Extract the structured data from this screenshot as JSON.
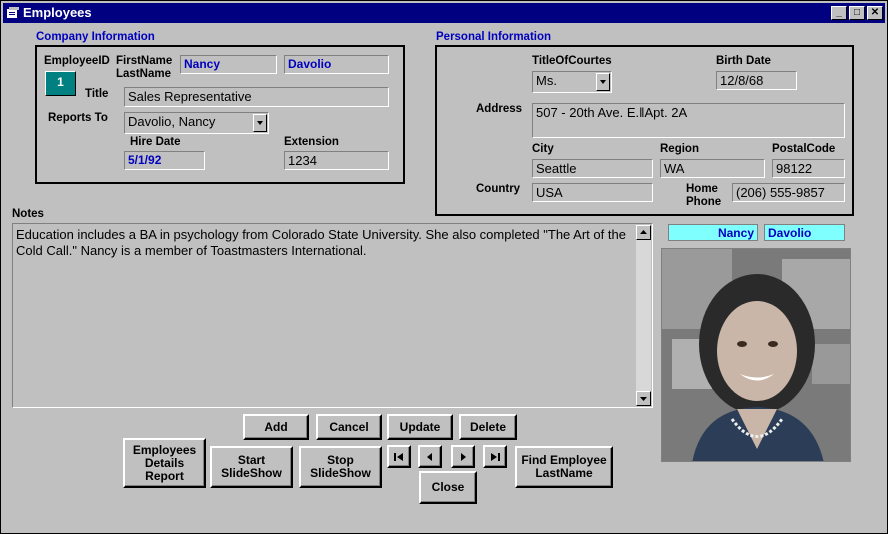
{
  "window": {
    "title": "Employees"
  },
  "company": {
    "heading": "Company Information",
    "employee_id_label": "EmployeeID",
    "employee_id": "1",
    "firstname_label": "FirstName",
    "lastname_label": "LastName",
    "first_name": "Nancy",
    "last_name": "Davolio",
    "title_label": "Title",
    "title": "Sales Representative",
    "reports_to_label": "Reports To",
    "reports_to": "Davolio, Nancy",
    "hire_date_label": "Hire Date",
    "hire_date": "5/1/92",
    "extension_label": "Extension",
    "extension": "1234"
  },
  "personal": {
    "heading": "Personal Information",
    "courtesy_label": "TitleOfCourtes",
    "courtesy": "Ms.",
    "birth_label": "Birth Date",
    "birth_date": "12/8/68",
    "address_label": "Address",
    "address": "507 - 20th Ave. E.‖Apt. 2A",
    "city_label": "City",
    "city": "Seattle",
    "region_label": "Region",
    "region": "WA",
    "postal_label": "PostalCode",
    "postal": "98122",
    "country_label": "Country",
    "country": "USA",
    "home_phone_label": "Home\nPhone",
    "home_phone": "(206) 555-9857"
  },
  "notes": {
    "label": "Notes",
    "text": "Education includes a BA in psychology from Colorado State University.  She also completed \"The Art of the Cold Call.\"  Nancy is a member of Toastmasters International."
  },
  "photo_caption": {
    "first": "Nancy",
    "last": "Davolio"
  },
  "buttons": {
    "add": "Add",
    "cancel": "Cancel",
    "update": "Update",
    "delete": "Delete",
    "report": "Employees\nDetails\nReport",
    "start": "Start\nSlideShow",
    "stop": "Stop\nSlideShow",
    "close": "Close",
    "find": "Find Employee\nLastName"
  },
  "colors": {
    "titlebar": "#000080",
    "accent_blue": "#0000c0",
    "teal": "#008080",
    "caption_bg": "#80ffff"
  }
}
